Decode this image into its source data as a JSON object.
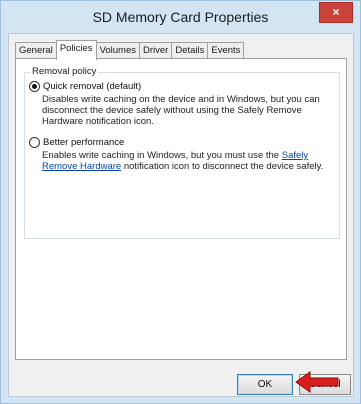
{
  "window": {
    "title": "SD Memory Card Properties",
    "close_glyph": "×"
  },
  "tabs": [
    {
      "label": "General",
      "active": false
    },
    {
      "label": "Policies",
      "active": true
    },
    {
      "label": "Volumes",
      "active": false
    },
    {
      "label": "Driver",
      "active": false
    },
    {
      "label": "Details",
      "active": false
    },
    {
      "label": "Events",
      "active": false
    }
  ],
  "removal_policy": {
    "group_label": "Removal policy",
    "quick_removal": {
      "label": "Quick removal (default)",
      "selected": true,
      "description": "Disables write caching on the device and in Windows, but you can disconnect the device safely without using the Safely Remove Hardware notification icon."
    },
    "better_performance": {
      "label": "Better performance",
      "selected": false,
      "description_before": "Enables write caching in Windows, but you must use the",
      "link_text": "Safely Remove Hardware",
      "description_after": "notification icon to disconnect the device safely."
    }
  },
  "buttons": {
    "ok": "OK",
    "cancel": "Cancel"
  },
  "annotation": {
    "arrow_color": "#d81e1e"
  }
}
